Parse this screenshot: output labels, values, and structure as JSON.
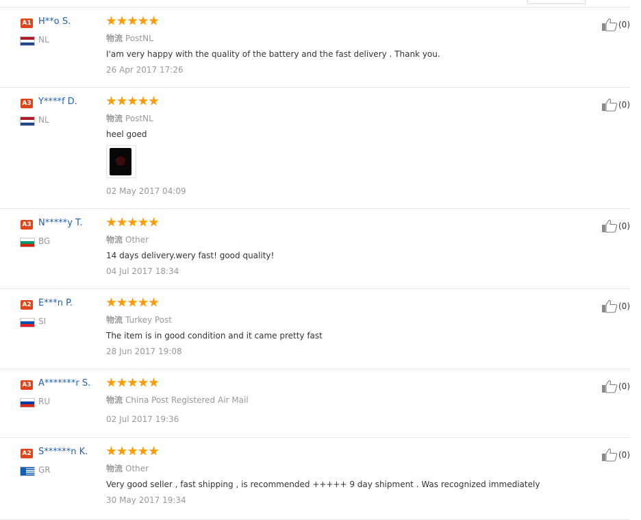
{
  "logistics_label": "物流",
  "reviews": [
    {
      "badge": "A1",
      "name": "H**o S.",
      "country": "NL",
      "flag": "nl",
      "stars": 5,
      "logistics": "PostNL",
      "comment": "I'am very happy with the quality of the battery and the fast delivery . Thank you.",
      "date": "26 Apr 2017 17:26",
      "useful": "(0)",
      "has_photo": false
    },
    {
      "badge": "A3",
      "name": "Y****f D.",
      "country": "NL",
      "flag": "nl",
      "stars": 5,
      "logistics": "PostNL",
      "comment": "heel goed",
      "date": "02 May 2017 04:09",
      "useful": "(0)",
      "has_photo": true
    },
    {
      "badge": "A3",
      "name": "N*****y T.",
      "country": "BG",
      "flag": "bg",
      "stars": 5,
      "logistics": "Other",
      "comment": "14 days delivery.wery fast! good quality!",
      "date": "04 Jul 2017 18:34",
      "useful": "(0)",
      "has_photo": false
    },
    {
      "badge": "A2",
      "name": "E***n P.",
      "country": "SI",
      "flag": "si",
      "stars": 5,
      "logistics": "Turkey Post",
      "comment": "The item is in good condition and it came pretty fast",
      "date": "28 Jun 2017 19:08",
      "useful": "(0)",
      "has_photo": false
    },
    {
      "badge": "A3",
      "name": "A*******r S.",
      "country": "RU",
      "flag": "ru",
      "stars": 5,
      "logistics": "China Post Registered Air Mail",
      "comment": "",
      "date": "02 Jul 2017 19:36",
      "useful": "(0)",
      "has_photo": false
    },
    {
      "badge": "A2",
      "name": "S******n K.",
      "country": "GR",
      "flag": "gr",
      "stars": 5,
      "logistics": "Other",
      "comment": "Very good seller , fast shipping , is recommended +++++ 9 day shipment . Was recognized immediately",
      "date": "30 May 2017 19:34",
      "useful": "(0)",
      "has_photo": false
    }
  ],
  "colors": {
    "badge": "#e0461b",
    "name": "#2160b8",
    "star": "#ff9a00",
    "muted": "#999999",
    "text": "#333333"
  }
}
